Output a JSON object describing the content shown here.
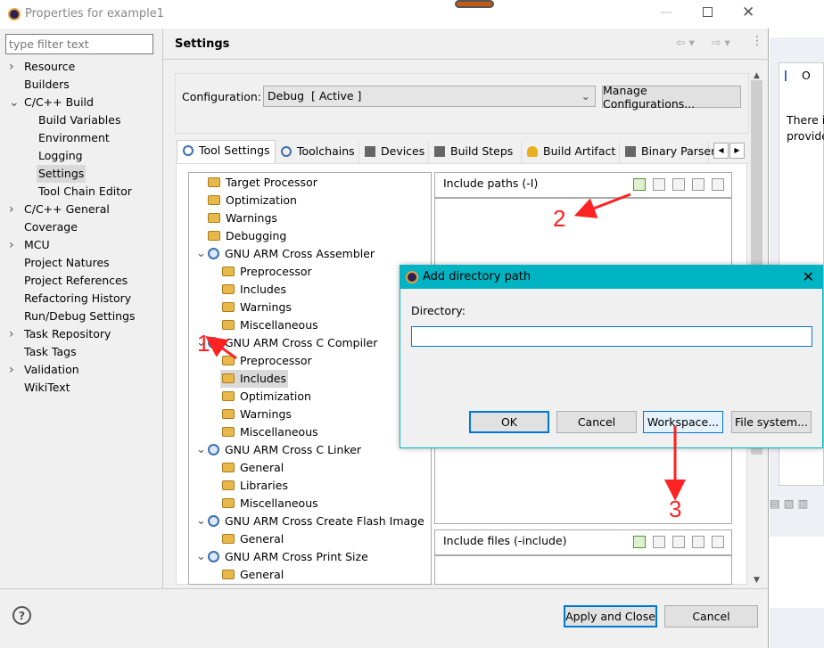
{
  "window": {
    "title": "Properties for example1"
  },
  "filter": {
    "placeholder": "type filter text"
  },
  "sidebar": {
    "items": [
      {
        "label": "Resource",
        "level": 0,
        "toggle": "collapsed"
      },
      {
        "label": "Builders",
        "level": 0
      },
      {
        "label": "C/C++ Build",
        "level": 0,
        "toggle": "expanded"
      },
      {
        "label": "Build Variables",
        "level": 1
      },
      {
        "label": "Environment",
        "level": 1
      },
      {
        "label": "Logging",
        "level": 1
      },
      {
        "label": "Settings",
        "level": 1,
        "selected": true
      },
      {
        "label": "Tool Chain Editor",
        "level": 1
      },
      {
        "label": "C/C++ General",
        "level": 0,
        "toggle": "collapsed"
      },
      {
        "label": "Coverage",
        "level": 0
      },
      {
        "label": "MCU",
        "level": 0,
        "toggle": "collapsed"
      },
      {
        "label": "Project Natures",
        "level": 0
      },
      {
        "label": "Project References",
        "level": 0
      },
      {
        "label": "Refactoring History",
        "level": 0
      },
      {
        "label": "Run/Debug Settings",
        "level": 0
      },
      {
        "label": "Task Repository",
        "level": 0,
        "toggle": "collapsed"
      },
      {
        "label": "Task Tags",
        "level": 0
      },
      {
        "label": "Validation",
        "level": 0,
        "toggle": "collapsed"
      },
      {
        "label": "WikiText",
        "level": 0
      }
    ]
  },
  "page": {
    "title": "Settings",
    "config_label": "Configuration:",
    "config_value": "Debug  [ Active ]",
    "manage_label": "Manage Configurations..."
  },
  "tabs": [
    {
      "label": "Tool Settings",
      "active": true
    },
    {
      "label": "Toolchains"
    },
    {
      "label": "Devices"
    },
    {
      "label": "Build Steps"
    },
    {
      "label": "Build Artifact"
    },
    {
      "label": "Binary Parsers"
    }
  ],
  "tool_tree": [
    {
      "label": "Target Processor",
      "level": 0,
      "icon": "folder"
    },
    {
      "label": "Optimization",
      "level": 0,
      "icon": "folder"
    },
    {
      "label": "Warnings",
      "level": 0,
      "icon": "folder"
    },
    {
      "label": "Debugging",
      "level": 0,
      "icon": "folder"
    },
    {
      "label": "GNU ARM Cross Assembler",
      "level": 0,
      "icon": "gear",
      "toggle": "expanded"
    },
    {
      "label": "Preprocessor",
      "level": 1,
      "icon": "folder"
    },
    {
      "label": "Includes",
      "level": 1,
      "icon": "folder"
    },
    {
      "label": "Warnings",
      "level": 1,
      "icon": "folder"
    },
    {
      "label": "Miscellaneous",
      "level": 1,
      "icon": "folder"
    },
    {
      "label": "GNU ARM Cross C Compiler",
      "level": 0,
      "icon": "gear",
      "toggle": "expanded"
    },
    {
      "label": "Preprocessor",
      "level": 1,
      "icon": "folder"
    },
    {
      "label": "Includes",
      "level": 1,
      "icon": "folder",
      "selected": true
    },
    {
      "label": "Optimization",
      "level": 1,
      "icon": "folder"
    },
    {
      "label": "Warnings",
      "level": 1,
      "icon": "folder"
    },
    {
      "label": "Miscellaneous",
      "level": 1,
      "icon": "folder"
    },
    {
      "label": "GNU ARM Cross C Linker",
      "level": 0,
      "icon": "gear",
      "toggle": "expanded"
    },
    {
      "label": "General",
      "level": 1,
      "icon": "folder"
    },
    {
      "label": "Libraries",
      "level": 1,
      "icon": "folder"
    },
    {
      "label": "Miscellaneous",
      "level": 1,
      "icon": "folder"
    },
    {
      "label": "GNU ARM Cross Create Flash Image",
      "level": 0,
      "icon": "gear",
      "toggle": "expanded"
    },
    {
      "label": "General",
      "level": 1,
      "icon": "folder"
    },
    {
      "label": "GNU ARM Cross Print Size",
      "level": 0,
      "icon": "gear",
      "toggle": "expanded"
    },
    {
      "label": "General",
      "level": 1,
      "icon": "folder"
    }
  ],
  "include_paths": {
    "title": "Include paths (-I)"
  },
  "include_files": {
    "title": "Include files (-include)"
  },
  "dialog": {
    "title": "Add directory path",
    "dir_label": "Directory:",
    "dir_value": "",
    "ok": "OK",
    "cancel": "Cancel",
    "workspace": "Workspace...",
    "filesystem": "File system...",
    "title_color": "#00b4c4"
  },
  "footer": {
    "apply": "Apply and Close",
    "cancel": "Cancel"
  },
  "background_app": {
    "tab_label": "O",
    "text1": "There is",
    "text2": "provide"
  },
  "annotations": [
    "1",
    "2",
    "3"
  ],
  "colors": {
    "annotation": "#ff2222",
    "selection": "#cce8ff",
    "focus": "#0078d7"
  }
}
